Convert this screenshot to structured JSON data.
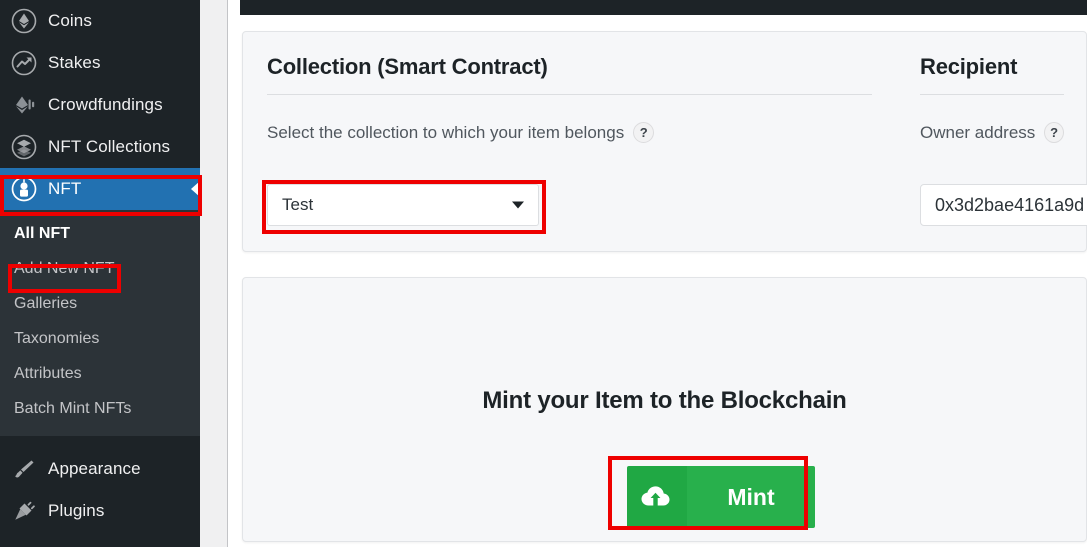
{
  "sidebar": {
    "items": [
      {
        "label": "Coins",
        "icon": "ethereum-circle-icon",
        "active": false
      },
      {
        "label": "Stakes",
        "icon": "trending-circle-icon",
        "active": false
      },
      {
        "label": "Crowdfundings",
        "icon": "ethereum-motion-icon",
        "active": false
      },
      {
        "label": "NFT Collections",
        "icon": "layers-circle-icon",
        "active": false
      },
      {
        "label": "NFT",
        "icon": "nft-badge-icon",
        "active": true
      }
    ],
    "submenu": [
      {
        "label": "All NFT",
        "current": true
      },
      {
        "label": "Add New NFT",
        "current": false
      },
      {
        "label": "Galleries",
        "current": false
      },
      {
        "label": "Taxonomies",
        "current": false
      },
      {
        "label": "Attributes",
        "current": false
      },
      {
        "label": "Batch Mint NFTs",
        "current": false
      }
    ],
    "bottom_items": [
      {
        "label": "Appearance",
        "icon": "paintbrush-icon"
      },
      {
        "label": "Plugins",
        "icon": "plug-icon"
      }
    ],
    "active_color": "#2271b1",
    "background_color": "#1d2327",
    "submenu_background_color": "#2c3338"
  },
  "collection_panel": {
    "title": "Collection (Smart Contract)",
    "field_label": "Select the collection to which your item belongs",
    "help_glyph": "?",
    "select_value": "Test",
    "caret_icon": "chevron-down-icon"
  },
  "recipient_panel": {
    "title": "Recipient",
    "field_label": "Owner address",
    "help_glyph": "?",
    "address_value": "0x3d2bae4161a9d"
  },
  "mint_panel": {
    "title": "Mint your Item to the Blockchain",
    "button_label": "Mint",
    "button_icon": "cloud-upload-icon",
    "button_color": "#28b04c",
    "button_icon_color": "#20a844"
  },
  "annotations": {
    "highlight_color": "#ee0000",
    "boxes": [
      {
        "target": "sidebar-item-nft"
      },
      {
        "target": "submenu-item-add-new-nft"
      },
      {
        "target": "collection-select"
      },
      {
        "target": "mint-button"
      }
    ]
  }
}
